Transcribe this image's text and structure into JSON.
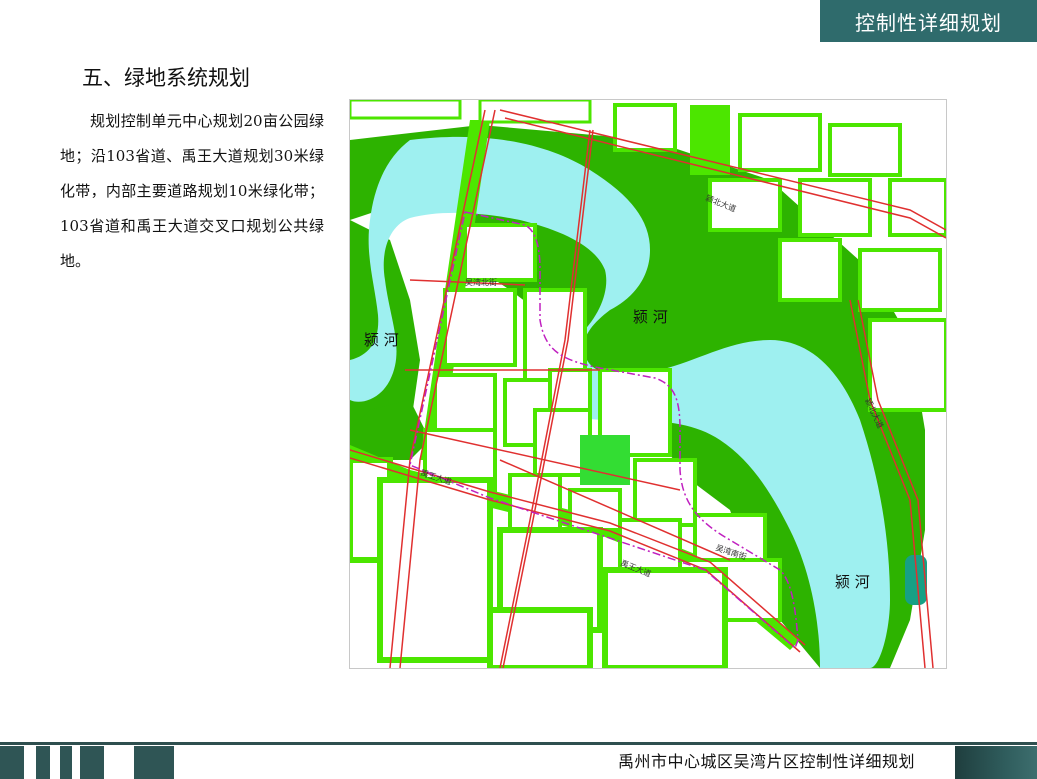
{
  "header": {
    "title": "控制性详细规划"
  },
  "section": {
    "title": "五、绿地系统规划",
    "body": "规划控制单元中心规划20亩公园绿地；沿103省道、禹王大道规划30米绿化带，内部主要道路规划10米绿化带；103省道和禹王大道交叉口规划公共绿地。"
  },
  "map": {
    "river_labels": [
      "颍  河",
      "颍  河",
      "颍  河"
    ],
    "road_labels": [
      "颍北大道",
      "颍北大道",
      "禹王大道",
      "禹王大道",
      "吴湾北街",
      "吴湾南街"
    ],
    "colors": {
      "dark_green": "#2db300",
      "light_green": "#4ce600",
      "river": "#9ef0f0",
      "road_red": "#e03030",
      "boundary": "#c020c0",
      "teal_pond": "#16a085"
    }
  },
  "footer": {
    "title": "禹州市中心城区吴湾片区控制性详细规划"
  }
}
